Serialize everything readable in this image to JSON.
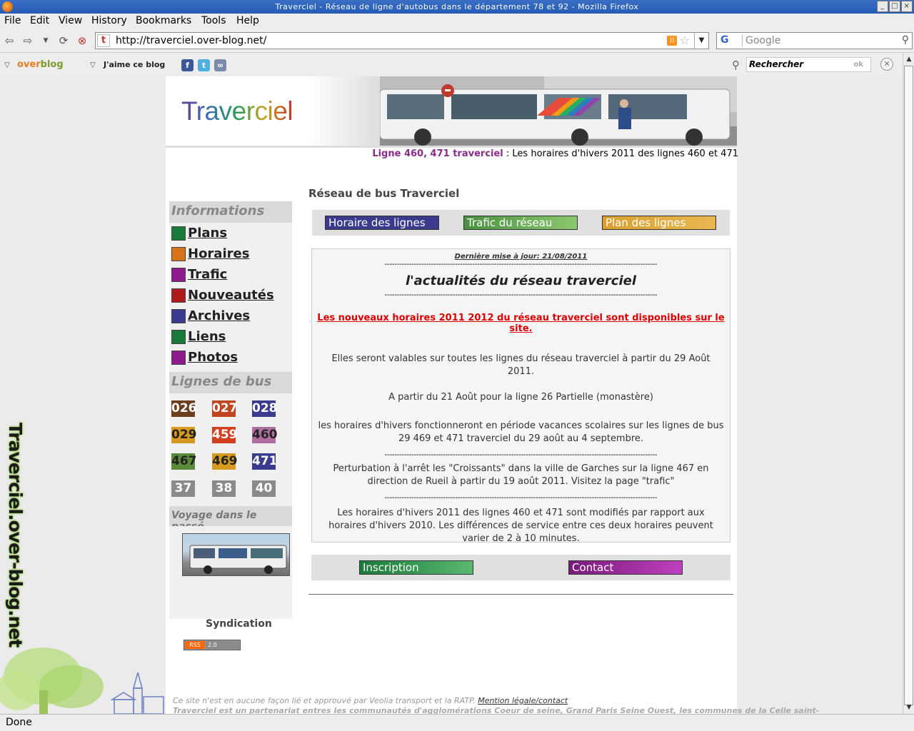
{
  "window": {
    "title": "Traverciel - Réseau de ligne d'autobus dans le département 78 et 92 - Mozilla Firefox"
  },
  "menu": [
    "File",
    "Edit",
    "View",
    "History",
    "Bookmarks",
    "Tools",
    "Help"
  ],
  "nav": {
    "url": "http://traverciel.over-blog.net/",
    "favicon_letter": "t",
    "search_placeholder": "Google",
    "search_engine": "G"
  },
  "overblog_toolbar": {
    "logo_a": "over",
    "logo_b": "blog",
    "like_label": "J'aime ce blog",
    "search_value": "Rechercher",
    "ok_label": "ok"
  },
  "status": "Done",
  "side": {
    "vertical_text": "Traverciel.over-blog.net"
  },
  "site": {
    "logo": "Traverciel",
    "newsline_highlight": "Ligne 460, 471 traverciel",
    "newsline_rest": " : Les horaires d'hivers 2011 des lignes 460 et 471"
  },
  "leftnav": {
    "info_title": "Informations",
    "items": [
      {
        "label": "Plans",
        "color": "#1a7a3a"
      },
      {
        "label": "Horaires",
        "color": "#d9731a"
      },
      {
        "label": "Trafic",
        "color": "#8e1a8e"
      },
      {
        "label": "Nouveautés",
        "color": "#b01a1a"
      },
      {
        "label": "Archives",
        "color": "#3a3a8e"
      },
      {
        "label": "Liens",
        "color": "#1a7a3a"
      },
      {
        "label": "Photos",
        "color": "#8e1a8e"
      }
    ],
    "lines_title": "Lignes de bus",
    "lines": [
      {
        "label": "026",
        "color": "#6b3e1e"
      },
      {
        "label": "027",
        "color": "#c0441e"
      },
      {
        "label": "028",
        "color": "#3a3a8e"
      },
      {
        "label": "029",
        "color": "#d59a1e"
      },
      {
        "label": "459",
        "color": "#d04020"
      },
      {
        "label": "460",
        "color": "#b06ea0"
      },
      {
        "label": "467",
        "color": "#5a8a3a"
      },
      {
        "label": "469",
        "color": "#d59a1e"
      },
      {
        "label": "471",
        "color": "#3a3a8e"
      },
      {
        "label": "37",
        "color": "#8a8a8a"
      },
      {
        "label": "38",
        "color": "#8a8a8a"
      },
      {
        "label": "40",
        "color": "#8a8a8a"
      }
    ],
    "voyage_title": "Voyage dans le passé",
    "syndication": "Syndication",
    "rss_a": "RSS",
    "rss_b": "2.0"
  },
  "main": {
    "title": "Réseau de bus Traverciel",
    "buttons": [
      {
        "label": "Horaire des lignes",
        "color": "#3a3a8e"
      },
      {
        "label": "Trafic du réseau",
        "color": "#5aa048"
      },
      {
        "label": "Plan des lignes",
        "color": "#d9a030"
      }
    ],
    "updated": "Dernière mise à jour: 21/08/2011",
    "dashes": "----------------------------------------------------------------------------------------------------------------",
    "news_heading": "l'actualités du réseau traverciel",
    "red_link": "Les nouveaux horaires 2011 2012 du réseau traverciel sont disponibles sur le site.",
    "p1": "Elles seront valables sur toutes les lignes du réseau traverciel à partir du 29 Août 2011.",
    "p2": "A partir du 21 Août pour la ligne 26 Partielle (monastère)",
    "p3": "les horaires d'hivers fonctionneront en période vacances scolaires sur les lignes de bus 29 469 et 471 traverciel du 29 août au 4 septembre.",
    "p4": "Perturbation à l'arrêt les \"Croissants\" dans la ville de Garches sur la ligne 467 en direction de Rueil à partir du 19 août 2011. Visitez la page \"trafic\"",
    "p5": "Les horaires d'hivers 2011 des lignes 460 et 471 sont modifiés par rapport aux horaires d'hivers 2010. Les différences de service entre ces deux horaires peuvent varier de 2 à 10 minutes.",
    "bottom_buttons": [
      {
        "label": "Inscription",
        "color": "#1a7a3a"
      },
      {
        "label": "Contact",
        "color": "#8e1a8e"
      }
    ]
  },
  "footer": {
    "line1": "Ce site n'est en aucune façon lié et approuvé par Veolia transport et la RATP.",
    "mention": "Mention légale/contact",
    "line2": "Traverciel est un partenariat entres les communautés d'agglomérations Coeur de seine, Grand Paris Seine Ouest, les communes de la Celle saint-"
  }
}
